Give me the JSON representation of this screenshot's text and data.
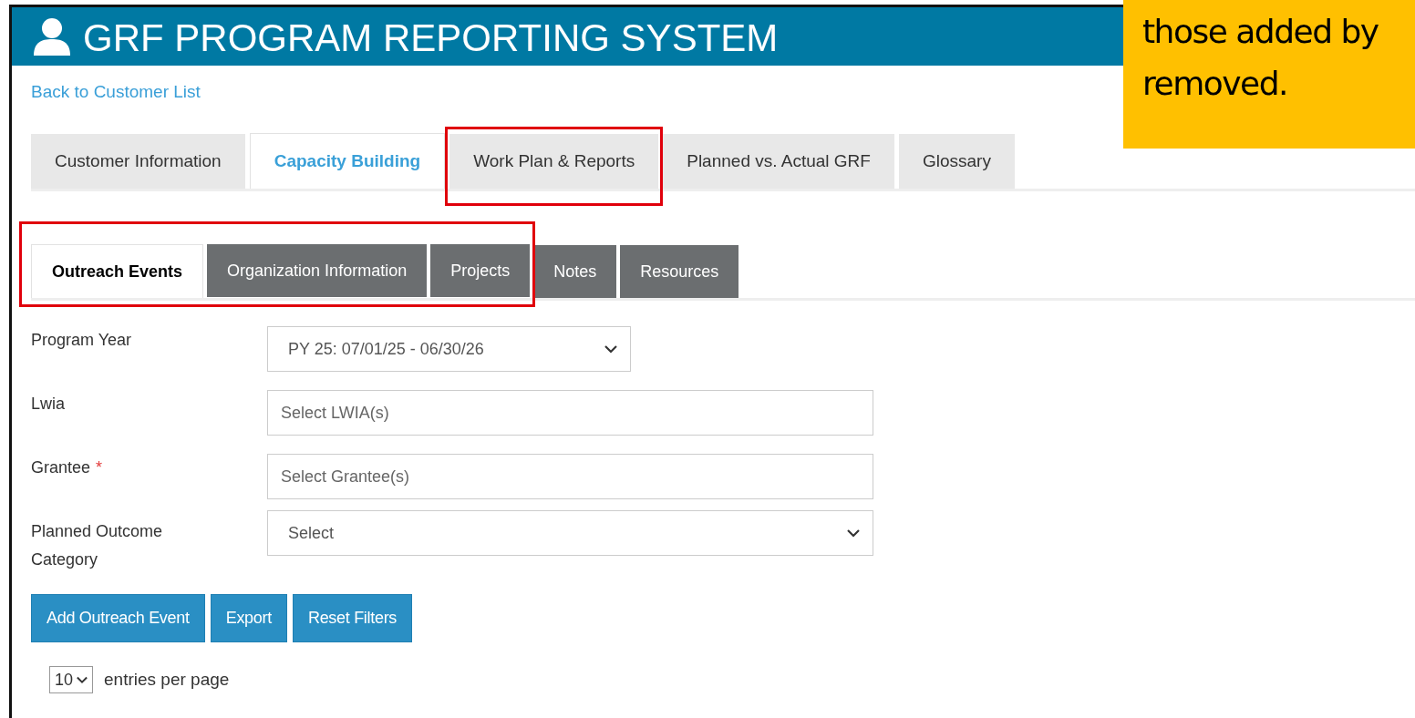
{
  "header": {
    "title": "GRF PROGRAM REPORTING SYSTEM"
  },
  "back_link": "Back to Customer List",
  "tabs": [
    {
      "label": "Customer Information",
      "selected": false,
      "highlighted": false
    },
    {
      "label": "Capacity Building",
      "selected": true,
      "highlighted": false
    },
    {
      "label": "Work Plan & Reports",
      "selected": false,
      "highlighted": true
    },
    {
      "label": "Planned vs. Actual GRF",
      "selected": false,
      "highlighted": false
    },
    {
      "label": "Glossary",
      "selected": false,
      "highlighted": false
    }
  ],
  "sub_tabs": [
    {
      "label": "Outreach Events",
      "selected": true,
      "highlighted": true
    },
    {
      "label": "Organization Information",
      "selected": false,
      "highlighted": true
    },
    {
      "label": "Projects",
      "selected": false,
      "highlighted": true
    },
    {
      "label": "Notes",
      "selected": false,
      "highlighted": false
    },
    {
      "label": "Resources",
      "selected": false,
      "highlighted": false
    }
  ],
  "filters": [
    {
      "label": "Program Year",
      "kind": "select",
      "value": "PY 25: 07/01/25 - 06/30/26"
    },
    {
      "label": "Lwia",
      "kind": "input",
      "placeholder": "Select LWIA(s)"
    },
    {
      "label": "Grantee",
      "required_mark": "*",
      "kind": "input",
      "placeholder": "Select Grantee(s)"
    },
    {
      "label": "Planned Outcome Category",
      "kind": "select",
      "value": "Select"
    }
  ],
  "buttons": [
    "Add Outreach Event",
    "Export",
    "Reset Filters"
  ],
  "page_size": {
    "value": "10",
    "label": "entries per page"
  },
  "callout": {
    "text": "those added by\nremoved."
  }
}
